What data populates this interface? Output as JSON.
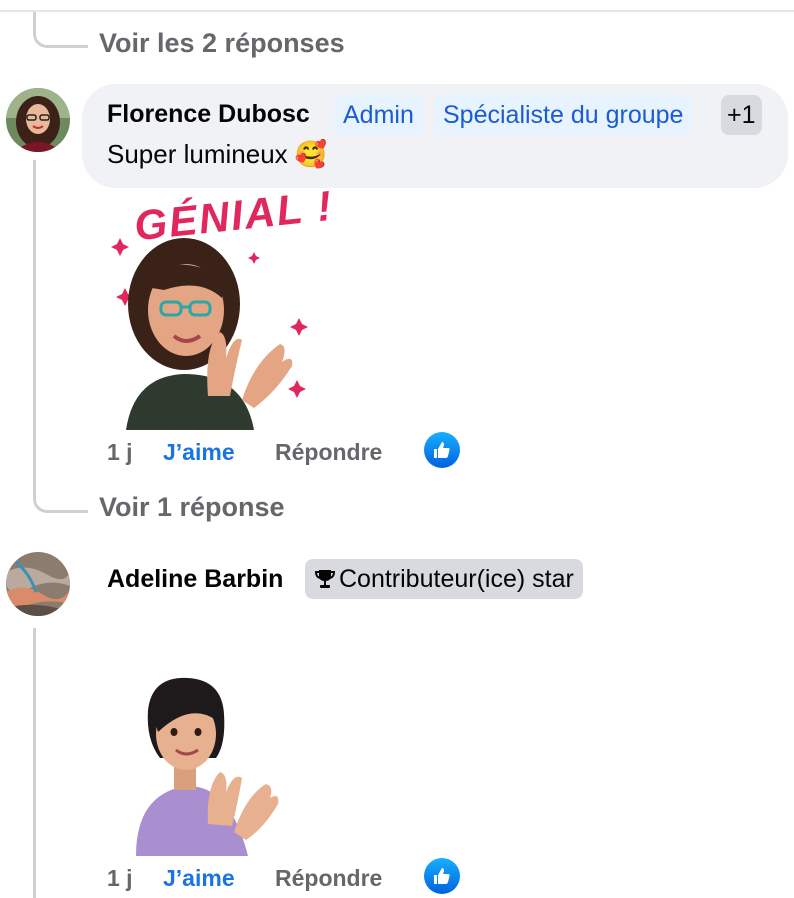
{
  "thread": {
    "top_replies_link": "Voir les 2 réponses",
    "middle_replies_link": "Voir 1 réponse"
  },
  "comments": [
    {
      "author": "Florence Dubosc",
      "badges": [
        "Admin",
        "Spécialiste du groupe",
        "+1"
      ],
      "text": "Super lumineux",
      "text_emoji": "🥰",
      "sticker_caption": "GÉNIAL !",
      "time": "1 j",
      "like_label": "J’aime",
      "reply_label": "Répondre"
    },
    {
      "author": "Adeline Barbin",
      "badge_icon": "trophy-icon",
      "badge": "Contributeur(ice) star",
      "time": "1 j",
      "like_label": "J’aime",
      "reply_label": "Répondre"
    }
  ],
  "colors": {
    "like_blue": "#1b74e4",
    "badge_blue_text": "#1b5bd3",
    "badge_blue_bg": "#e7f3ff",
    "bubble_bg": "#f0f2f5",
    "muted_text": "#65676b",
    "sticker_pink": "#e0285f"
  }
}
